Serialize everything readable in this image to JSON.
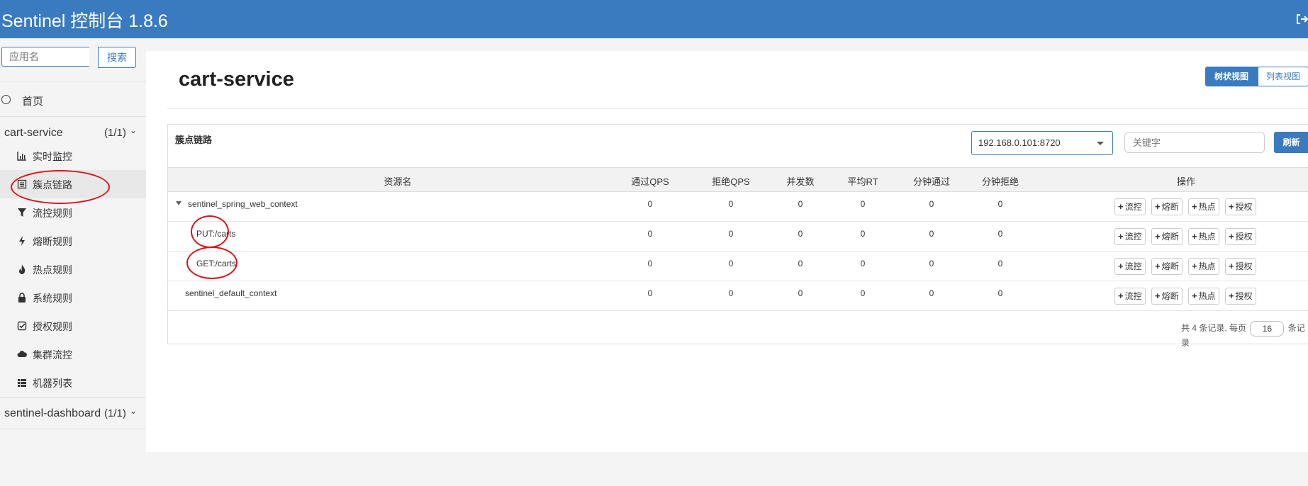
{
  "header": {
    "title": "Sentinel 控制台 1.8.6"
  },
  "sidebar": {
    "search_placeholder": "应用名",
    "search_button": "搜索",
    "home_label": "首页",
    "apps": [
      {
        "name": "cart-service",
        "count": "(1/1)"
      },
      {
        "name": "sentinel-dashboard",
        "count": "(1/1)"
      }
    ],
    "menu": [
      {
        "label": "实时监控",
        "icon": "bar-chart-icon"
      },
      {
        "label": "簇点链路",
        "icon": "list-icon"
      },
      {
        "label": "流控规则",
        "icon": "filter-icon"
      },
      {
        "label": "熔断规则",
        "icon": "flash-icon"
      },
      {
        "label": "热点规则",
        "icon": "fire-icon"
      },
      {
        "label": "系统规则",
        "icon": "lock-icon"
      },
      {
        "label": "授权规则",
        "icon": "check-square-icon"
      },
      {
        "label": "集群流控",
        "icon": "cloud-icon"
      },
      {
        "label": "机器列表",
        "icon": "th-list-icon"
      }
    ],
    "active_menu": "簇点链路"
  },
  "main": {
    "title": "cart-service",
    "view_tree": "树状视图",
    "view_list": "列表视图",
    "panel_title": "簇点链路",
    "machine": "192.168.0.101:8720",
    "keyword_placeholder": "关键字",
    "refresh": "刷新",
    "columns": [
      "资源名",
      "通过QPS",
      "拒绝QPS",
      "并发数",
      "平均RT",
      "分钟通过",
      "分钟拒绝",
      "操作"
    ],
    "rows": [
      {
        "name": "sentinel_spring_web_context",
        "values": [
          "0",
          "0",
          "0",
          "0",
          "0",
          "0"
        ]
      },
      {
        "name": "PUT:/carts",
        "values": [
          "0",
          "0",
          "0",
          "0",
          "0",
          "0"
        ]
      },
      {
        "name": "GET:/carts",
        "values": [
          "0",
          "0",
          "0",
          "0",
          "0",
          "0"
        ]
      },
      {
        "name": "sentinel_default_context",
        "values": [
          "0",
          "0",
          "0",
          "0",
          "0",
          "0"
        ]
      }
    ],
    "ops": [
      "流控",
      "熔断",
      "热点",
      "授权"
    ],
    "pager": {
      "prefix": "共 4 条记录, 每页",
      "page_size": "16",
      "suffix": "条记录"
    }
  },
  "colors": {
    "brand": "#3a7bbf",
    "highlight": "#d9141a"
  }
}
